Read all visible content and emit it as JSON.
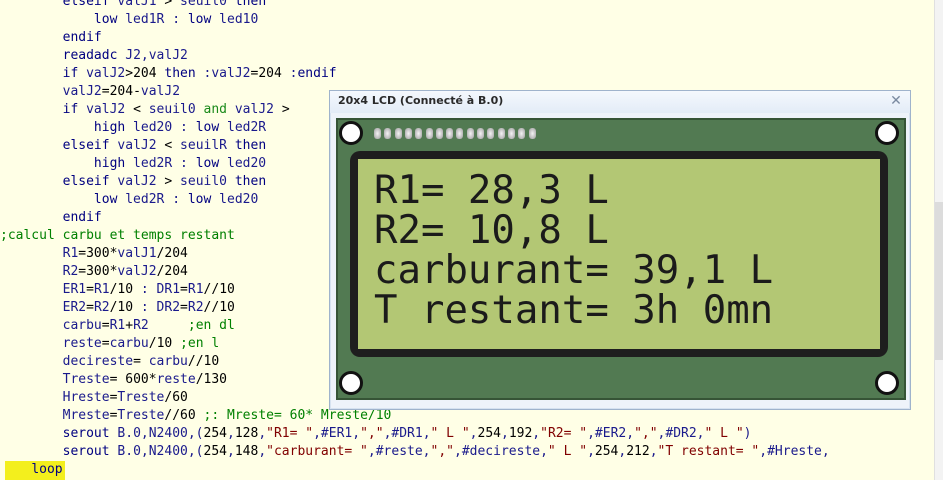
{
  "editor": {
    "lines": [
      {
        "indent": "        ",
        "tokens": [
          {
            "t": "kw",
            "v": "elseif"
          },
          {
            "t": "txt",
            "v": " valJ1 "
          },
          {
            "t": "op",
            "v": ">"
          },
          {
            "t": "txt",
            "v": " seuil0 "
          },
          {
            "t": "kw",
            "v": "then"
          }
        ]
      },
      {
        "indent": "            ",
        "tokens": [
          {
            "t": "kw",
            "v": "low"
          },
          {
            "t": "txt",
            "v": " led1R : "
          },
          {
            "t": "kw",
            "v": "low"
          },
          {
            "t": "txt",
            "v": " led10"
          }
        ]
      },
      {
        "indent": "        ",
        "tokens": [
          {
            "t": "kw",
            "v": "endif"
          }
        ]
      },
      {
        "indent": "        ",
        "tokens": [
          {
            "t": "kw",
            "v": "readadc"
          },
          {
            "t": "txt",
            "v": " J2,valJ2"
          }
        ]
      },
      {
        "indent": "        ",
        "tokens": [
          {
            "t": "kw",
            "v": "if"
          },
          {
            "t": "txt",
            "v": " valJ2"
          },
          {
            "t": "op",
            "v": ">"
          },
          {
            "t": "num",
            "v": "204"
          },
          {
            "t": "txt",
            "v": " "
          },
          {
            "t": "kw",
            "v": "then"
          },
          {
            "t": "txt",
            "v": " :valJ2"
          },
          {
            "t": "op",
            "v": "="
          },
          {
            "t": "num",
            "v": "204"
          },
          {
            "t": "txt",
            "v": " :"
          },
          {
            "t": "kw",
            "v": "endif"
          }
        ]
      },
      {
        "indent": "        ",
        "tokens": [
          {
            "t": "txt",
            "v": "valJ2"
          },
          {
            "t": "op",
            "v": "="
          },
          {
            "t": "num",
            "v": "204"
          },
          {
            "t": "op",
            "v": "-"
          },
          {
            "t": "txt",
            "v": "valJ2"
          }
        ]
      },
      {
        "indent": "        ",
        "tokens": [
          {
            "t": "kw",
            "v": "if"
          },
          {
            "t": "txt",
            "v": " valJ2 "
          },
          {
            "t": "op",
            "v": "<"
          },
          {
            "t": "txt",
            "v": " seuil0 "
          },
          {
            "t": "ok",
            "v": "and"
          },
          {
            "t": "txt",
            "v": " valJ2 "
          },
          {
            "t": "op",
            "v": ">"
          }
        ]
      },
      {
        "indent": "            ",
        "tokens": [
          {
            "t": "kw",
            "v": "high"
          },
          {
            "t": "txt",
            "v": " led20 : "
          },
          {
            "t": "kw",
            "v": "low"
          },
          {
            "t": "txt",
            "v": " led2R"
          }
        ]
      },
      {
        "indent": "        ",
        "tokens": [
          {
            "t": "kw",
            "v": "elseif"
          },
          {
            "t": "txt",
            "v": " valJ2 "
          },
          {
            "t": "op",
            "v": "<"
          },
          {
            "t": "txt",
            "v": " seuilR "
          },
          {
            "t": "kw",
            "v": "then"
          }
        ]
      },
      {
        "indent": "            ",
        "tokens": [
          {
            "t": "kw",
            "v": "high"
          },
          {
            "t": "txt",
            "v": " led2R : "
          },
          {
            "t": "kw",
            "v": "low"
          },
          {
            "t": "txt",
            "v": " led20"
          }
        ]
      },
      {
        "indent": "        ",
        "tokens": [
          {
            "t": "kw",
            "v": "elseif"
          },
          {
            "t": "txt",
            "v": " valJ2 "
          },
          {
            "t": "op",
            "v": ">"
          },
          {
            "t": "txt",
            "v": " seuil0 "
          },
          {
            "t": "kw",
            "v": "then"
          }
        ]
      },
      {
        "indent": "            ",
        "tokens": [
          {
            "t": "kw",
            "v": "low"
          },
          {
            "t": "txt",
            "v": " led2R : "
          },
          {
            "t": "kw",
            "v": "low"
          },
          {
            "t": "txt",
            "v": " led20"
          }
        ]
      },
      {
        "indent": "        ",
        "tokens": [
          {
            "t": "kw",
            "v": "endif"
          }
        ]
      },
      {
        "indent": "",
        "tokens": [
          {
            "t": "cm",
            "v": ";calcul carbu et temps restant"
          }
        ]
      },
      {
        "indent": "        ",
        "tokens": [
          {
            "t": "txt",
            "v": "R1"
          },
          {
            "t": "op",
            "v": "="
          },
          {
            "t": "num",
            "v": "300"
          },
          {
            "t": "op",
            "v": "*"
          },
          {
            "t": "txt",
            "v": "valJ1"
          },
          {
            "t": "op",
            "v": "/"
          },
          {
            "t": "num",
            "v": "204"
          }
        ]
      },
      {
        "indent": "        ",
        "tokens": [
          {
            "t": "txt",
            "v": "R2"
          },
          {
            "t": "op",
            "v": "="
          },
          {
            "t": "num",
            "v": "300"
          },
          {
            "t": "op",
            "v": "*"
          },
          {
            "t": "txt",
            "v": "valJ2"
          },
          {
            "t": "op",
            "v": "/"
          },
          {
            "t": "num",
            "v": "204"
          }
        ]
      },
      {
        "indent": "        ",
        "tokens": [
          {
            "t": "txt",
            "v": "ER1"
          },
          {
            "t": "op",
            "v": "="
          },
          {
            "t": "txt",
            "v": "R1"
          },
          {
            "t": "op",
            "v": "/"
          },
          {
            "t": "num",
            "v": "10"
          },
          {
            "t": "txt",
            "v": " : DR1"
          },
          {
            "t": "op",
            "v": "="
          },
          {
            "t": "txt",
            "v": "R1"
          },
          {
            "t": "op",
            "v": "//"
          },
          {
            "t": "num",
            "v": "10"
          }
        ]
      },
      {
        "indent": "        ",
        "tokens": [
          {
            "t": "txt",
            "v": "ER2"
          },
          {
            "t": "op",
            "v": "="
          },
          {
            "t": "txt",
            "v": "R2"
          },
          {
            "t": "op",
            "v": "/"
          },
          {
            "t": "num",
            "v": "10"
          },
          {
            "t": "txt",
            "v": " : DR2"
          },
          {
            "t": "op",
            "v": "="
          },
          {
            "t": "txt",
            "v": "R2"
          },
          {
            "t": "op",
            "v": "//"
          },
          {
            "t": "num",
            "v": "10"
          }
        ]
      },
      {
        "indent": "        ",
        "tokens": [
          {
            "t": "txt",
            "v": "carbu"
          },
          {
            "t": "op",
            "v": "="
          },
          {
            "t": "txt",
            "v": "R1"
          },
          {
            "t": "op",
            "v": "+"
          },
          {
            "t": "txt",
            "v": "R2     "
          },
          {
            "t": "cm",
            "v": ";en dl"
          }
        ]
      },
      {
        "indent": "        ",
        "tokens": [
          {
            "t": "txt",
            "v": "reste"
          },
          {
            "t": "op",
            "v": "="
          },
          {
            "t": "txt",
            "v": "carbu"
          },
          {
            "t": "op",
            "v": "/"
          },
          {
            "t": "num",
            "v": "10"
          },
          {
            "t": "txt",
            "v": " "
          },
          {
            "t": "cm",
            "v": ";en l"
          }
        ]
      },
      {
        "indent": "        ",
        "tokens": [
          {
            "t": "txt",
            "v": "decireste"
          },
          {
            "t": "op",
            "v": "="
          },
          {
            "t": "txt",
            "v": " carbu"
          },
          {
            "t": "op",
            "v": "//"
          },
          {
            "t": "num",
            "v": "10"
          }
        ]
      },
      {
        "indent": "        ",
        "tokens": [
          {
            "t": "txt",
            "v": "Treste"
          },
          {
            "t": "op",
            "v": "="
          },
          {
            "t": "txt",
            "v": " "
          },
          {
            "t": "num",
            "v": "600"
          },
          {
            "t": "op",
            "v": "*"
          },
          {
            "t": "txt",
            "v": "reste"
          },
          {
            "t": "op",
            "v": "/"
          },
          {
            "t": "num",
            "v": "130"
          }
        ]
      },
      {
        "indent": "        ",
        "tokens": [
          {
            "t": "txt",
            "v": "Hreste"
          },
          {
            "t": "op",
            "v": "="
          },
          {
            "t": "txt",
            "v": "Treste"
          },
          {
            "t": "op",
            "v": "/"
          },
          {
            "t": "num",
            "v": "60"
          }
        ]
      },
      {
        "indent": "        ",
        "tokens": [
          {
            "t": "txt",
            "v": "Mreste"
          },
          {
            "t": "op",
            "v": "="
          },
          {
            "t": "txt",
            "v": "Treste"
          },
          {
            "t": "op",
            "v": "//"
          },
          {
            "t": "num",
            "v": "60"
          },
          {
            "t": "txt",
            "v": " "
          },
          {
            "t": "cm",
            "v": ";: Mreste= 60* Mreste/10"
          }
        ]
      },
      {
        "indent": "        ",
        "tokens": [
          {
            "t": "kw",
            "v": "serout"
          },
          {
            "t": "txt",
            "v": " B.0,N2400,("
          },
          {
            "t": "num",
            "v": "254"
          },
          {
            "t": "txt",
            "v": ","
          },
          {
            "t": "num",
            "v": "128"
          },
          {
            "t": "txt",
            "v": ","
          },
          {
            "t": "str",
            "v": "\"R1= \""
          },
          {
            "t": "txt",
            "v": ",#ER1,"
          },
          {
            "t": "str",
            "v": "\",\""
          },
          {
            "t": "txt",
            "v": ",#DR1,"
          },
          {
            "t": "str",
            "v": "\" L \""
          },
          {
            "t": "txt",
            "v": ","
          },
          {
            "t": "num",
            "v": "254"
          },
          {
            "t": "txt",
            "v": ","
          },
          {
            "t": "num",
            "v": "192"
          },
          {
            "t": "txt",
            "v": ","
          },
          {
            "t": "str",
            "v": "\"R2= \""
          },
          {
            "t": "txt",
            "v": ",#ER2,"
          },
          {
            "t": "str",
            "v": "\",\""
          },
          {
            "t": "txt",
            "v": ",#DR2,"
          },
          {
            "t": "str",
            "v": "\" L \""
          },
          {
            "t": "txt",
            "v": ")"
          }
        ]
      },
      {
        "indent": "        ",
        "tokens": [
          {
            "t": "kw",
            "v": "serout"
          },
          {
            "t": "txt",
            "v": " B.0,N2400,("
          },
          {
            "t": "num",
            "v": "254"
          },
          {
            "t": "txt",
            "v": ","
          },
          {
            "t": "num",
            "v": "148"
          },
          {
            "t": "txt",
            "v": ","
          },
          {
            "t": "str",
            "v": "\"carburant= \""
          },
          {
            "t": "txt",
            "v": ",#reste,"
          },
          {
            "t": "str",
            "v": "\",\""
          },
          {
            "t": "txt",
            "v": ",#decireste,"
          },
          {
            "t": "str",
            "v": "\" L \""
          },
          {
            "t": "txt",
            "v": ","
          },
          {
            "t": "num",
            "v": "254"
          },
          {
            "t": "txt",
            "v": ","
          },
          {
            "t": "num",
            "v": "212"
          },
          {
            "t": "txt",
            "v": ","
          },
          {
            "t": "str",
            "v": "\"T restant= \""
          },
          {
            "t": "txt",
            "v": ",#Hreste,"
          }
        ]
      },
      {
        "indent": "    ",
        "tokens": [
          {
            "t": "kw",
            "v": "loop"
          }
        ]
      }
    ]
  },
  "lcd_window": {
    "title": "20x4 LCD (Connecté à B.0)",
    "close_glyph": "✕",
    "rows": [
      "R1= 28,3 L",
      "R2= 10,8 L",
      "carburant= 39,1 L",
      "T restant= 3h 0mn"
    ]
  },
  "colors": {
    "editor_bg": "#ffffe6",
    "keyword": "#000080",
    "comment": "#008000",
    "string": "#800000",
    "current_line": "#f3ef1d",
    "lcd_board": "#527a52",
    "lcd_screen": "#b3c774"
  }
}
